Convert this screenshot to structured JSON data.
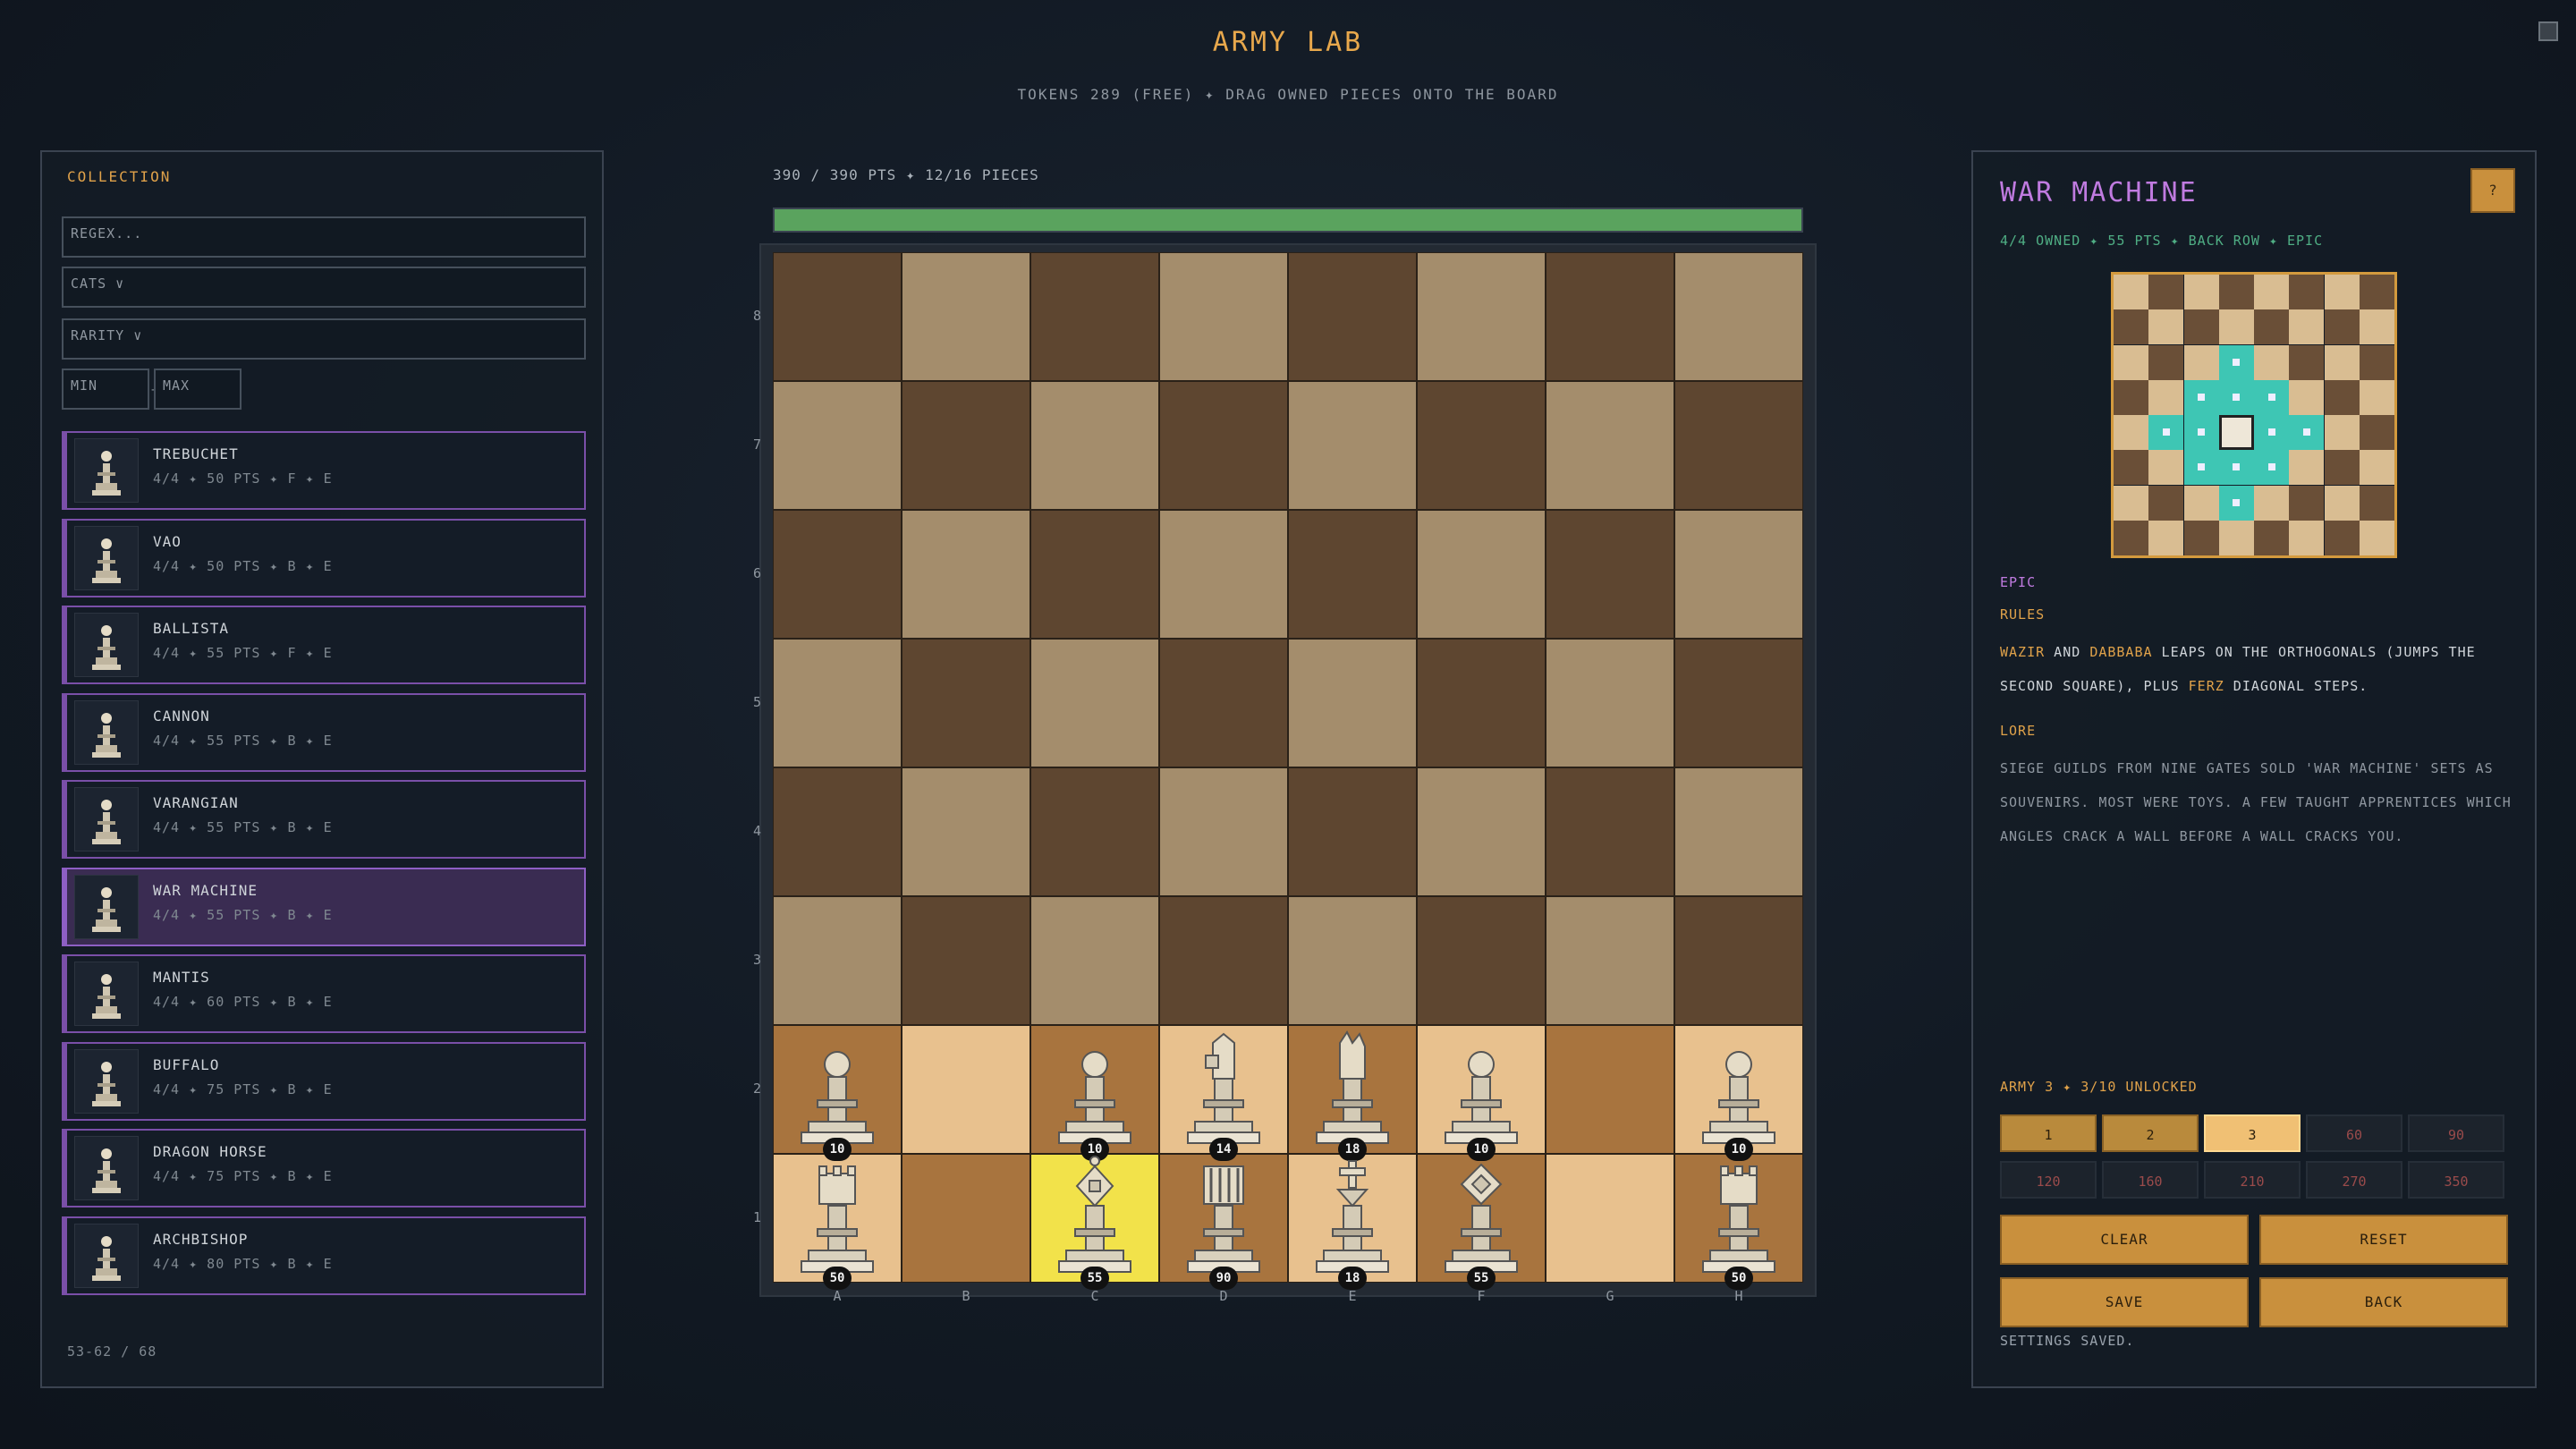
{
  "header": {
    "title": "ARMY LAB",
    "subtitle": "TOKENS 289 (FREE)  ✦  DRAG OWNED PIECES ONTO THE BOARD"
  },
  "collection": {
    "title": "COLLECTION",
    "regex_placeholder": "REGEX...",
    "cats_label": "CATS ∨",
    "rarity_label": "RARITY ∨",
    "min_placeholder": "MIN",
    "range_sep": "-",
    "max_placeholder": "MAX",
    "footer": "53-62 / 68",
    "pieces": [
      {
        "name": "TREBUCHET",
        "meta": "4/4 ✦ 50 PTS ✦ F ✦ E",
        "icon": "trebuchet-icon"
      },
      {
        "name": "VAO",
        "meta": "4/4 ✦ 50 PTS ✦ B ✦ E",
        "icon": "vao-icon"
      },
      {
        "name": "BALLISTA",
        "meta": "4/4 ✦ 55 PTS ✦ F ✦ E",
        "icon": "ballista-icon"
      },
      {
        "name": "CANNON",
        "meta": "4/4 ✦ 55 PTS ✦ B ✦ E",
        "icon": "cannon-icon"
      },
      {
        "name": "VARANGIAN",
        "meta": "4/4 ✦ 55 PTS ✦ B ✦ E",
        "icon": "varangian-icon"
      },
      {
        "name": "WAR MACHINE",
        "meta": "4/4 ✦ 55 PTS ✦ B ✦ E",
        "icon": "war-machine-icon",
        "selected": true
      },
      {
        "name": "MANTIS",
        "meta": "4/4 ✦ 60 PTS ✦ B ✦ E",
        "icon": "mantis-icon"
      },
      {
        "name": "BUFFALO",
        "meta": "4/4 ✦ 75 PTS ✦ B ✦ E",
        "icon": "buffalo-icon"
      },
      {
        "name": "DRAGON HORSE",
        "meta": "4/4 ✦ 75 PTS ✦ B ✦ E",
        "icon": "dragon-horse-icon"
      },
      {
        "name": "ARCHBISHOP",
        "meta": "4/4 ✦ 80 PTS ✦ B ✦ E",
        "icon": "archbishop-icon"
      }
    ]
  },
  "army": {
    "stats": "390 / 390 PTS   ✦   12/16 PIECES",
    "progress": 1.0,
    "ranks": [
      "8",
      "7",
      "6",
      "5",
      "4",
      "3",
      "2",
      "1"
    ],
    "files": [
      "A",
      "B",
      "C",
      "D",
      "E",
      "F",
      "G",
      "H"
    ],
    "pieces_on_board": [
      {
        "square": "a2",
        "type": "pawn",
        "value": "10"
      },
      {
        "square": "c2",
        "type": "pawn",
        "value": "10"
      },
      {
        "square": "d2",
        "type": "rook-bent",
        "value": "14"
      },
      {
        "square": "e2",
        "type": "hand",
        "value": "18"
      },
      {
        "square": "f2",
        "type": "pawn",
        "value": "10"
      },
      {
        "square": "h2",
        "type": "pawn",
        "value": "10"
      },
      {
        "square": "a1",
        "type": "rook",
        "value": "50"
      },
      {
        "square": "c1",
        "type": "war-machine",
        "value": "55"
      },
      {
        "square": "d1",
        "type": "crown-rook",
        "value": "90"
      },
      {
        "square": "e1",
        "type": "king-cross",
        "value": "18"
      },
      {
        "square": "f1",
        "type": "diamond",
        "value": "55"
      },
      {
        "square": "h1",
        "type": "rook",
        "value": "50"
      }
    ],
    "highlight_square": "c1"
  },
  "detail": {
    "title": "WAR MACHINE",
    "help_label": "?",
    "meta": "4/4 OWNED ✦ 55 PTS ✦ BACK ROW ✦ EPIC",
    "rarity": "EPIC",
    "rules_head": "RULES",
    "rules_parts": [
      "WAZIR",
      " AND ",
      "DABBABA",
      " LEAPS ON THE ORTHOGONALS (JUMPS THE SECOND SQUARE), PLUS ",
      "FERZ",
      " DIAGONAL STEPS."
    ],
    "lore_head": "LORE",
    "lore_text": "SIEGE GUILDS FROM NINE GATES SOLD 'WAR MACHINE' SETS AS SOUVENIRS. MOST WERE TOYS. A FEW TAUGHT APPRENTICES WHICH ANGLES CRACK A WALL BEFORE A WALL CRACKS YOU.",
    "army_head": "ARMY 3  ✦  3/10 UNLOCKED",
    "slots": [
      {
        "label": "1",
        "state": "unlocked"
      },
      {
        "label": "2",
        "state": "unlocked"
      },
      {
        "label": "3",
        "state": "active"
      },
      {
        "label": "60",
        "state": "locked"
      },
      {
        "label": "90",
        "state": "locked"
      },
      {
        "label": "120",
        "state": "locked"
      },
      {
        "label": "160",
        "state": "locked"
      },
      {
        "label": "210",
        "state": "locked"
      },
      {
        "label": "270",
        "state": "locked"
      },
      {
        "label": "350",
        "state": "locked"
      }
    ],
    "clear_label": "CLEAR",
    "reset_label": "RESET",
    "save_label": "SAVE",
    "back_label": "BACK",
    "status": "SETTINGS SAVED."
  },
  "colors": {
    "accent": "#e0a24a",
    "epic": "#c07be0",
    "progress": "#5aa35e",
    "light_square": "#a48d6c",
    "dark_square": "#5e4630",
    "move_cell": "#3ec6b4",
    "highlight": "#f2e24a"
  }
}
